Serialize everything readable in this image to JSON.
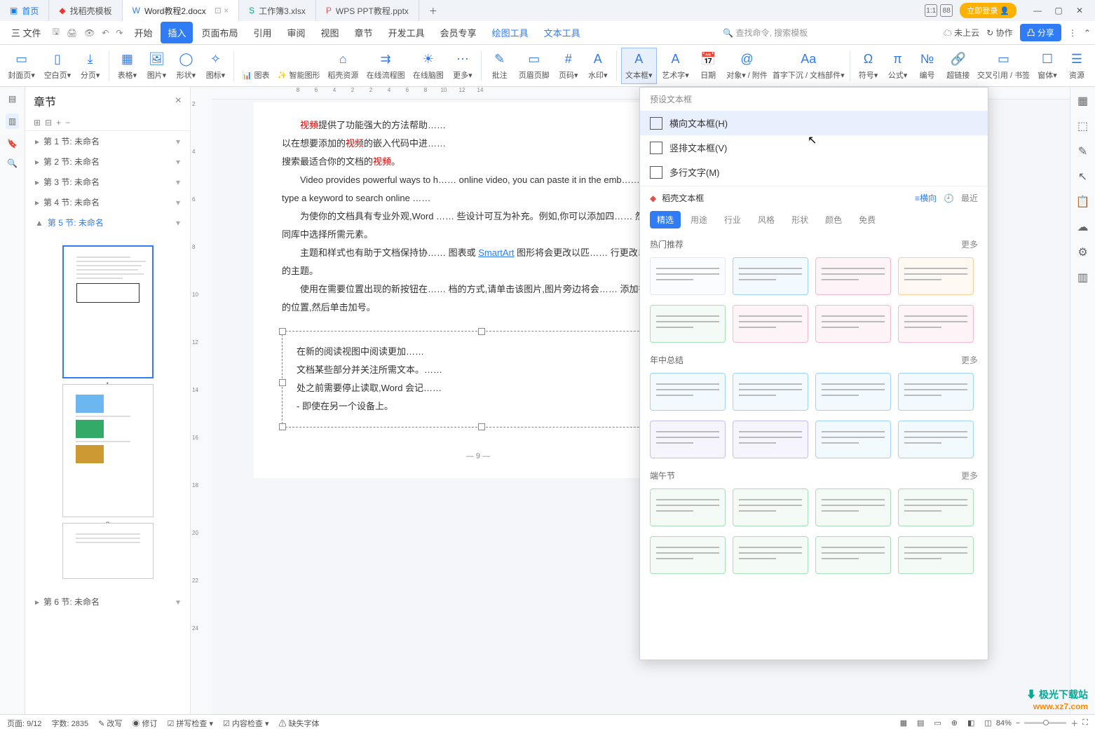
{
  "title_tabs": {
    "home": "首页",
    "t1": "找稻壳模板",
    "t2": "Word教程2.docx",
    "t3": "工作簿3.xlsx",
    "t4": "WPS PPT教程.pptx"
  },
  "win": {
    "login": "立即登录",
    "box1": "1:1",
    "box2": "88"
  },
  "menu": {
    "file": "三 文件",
    "items": [
      "开始",
      "插入",
      "页面布局",
      "引用",
      "审阅",
      "视图",
      "章节",
      "开发工具",
      "会员专享",
      "绘图工具",
      "文本工具"
    ],
    "active_index": 1,
    "search": "🔍 查找命令, 搜索模板",
    "right": {
      "cloud": "未上云",
      "coop": "协作",
      "share": "凸 分享"
    }
  },
  "ribbon": {
    "items": [
      {
        "lbl": "封面页▾",
        "ic": "▭"
      },
      {
        "lbl": "空白页▾",
        "ic": "▯"
      },
      {
        "lbl": "分页▾",
        "ic": "⤓"
      },
      {
        "lbl": "表格▾",
        "ic": "▦"
      },
      {
        "lbl": "图片▾",
        "ic": "🖼"
      },
      {
        "lbl": "形状▾",
        "ic": "◯"
      },
      {
        "lbl": "图标▾",
        "ic": "✧"
      },
      {
        "lbl": "📊 图表",
        "ic": ""
      },
      {
        "lbl": "✨ 智能图形",
        "ic": ""
      },
      {
        "lbl": "稻壳资源",
        "ic": "⌂"
      },
      {
        "lbl": "在线流程图",
        "ic": "⇉"
      },
      {
        "lbl": "在线脑图",
        "ic": "☀"
      },
      {
        "lbl": "更多▾",
        "ic": "⋯"
      },
      {
        "lbl": "批注",
        "ic": "✎"
      },
      {
        "lbl": "页眉页脚",
        "ic": "▭"
      },
      {
        "lbl": "页码▾",
        "ic": "#"
      },
      {
        "lbl": "水印▾",
        "ic": "A"
      },
      {
        "lbl": "文本框▾",
        "ic": "A",
        "sel": true
      },
      {
        "lbl": "艺术字▾",
        "ic": "A"
      },
      {
        "lbl": "日期",
        "ic": "📅"
      },
      {
        "lbl": "对象▾ / 附件",
        "ic": "@"
      },
      {
        "lbl": "首字下沉 / 文档部件▾",
        "ic": "Aa"
      },
      {
        "lbl": "符号▾",
        "ic": "Ω"
      },
      {
        "lbl": "公式▾",
        "ic": "π"
      },
      {
        "lbl": "编号",
        "ic": "№"
      },
      {
        "lbl": "超链接",
        "ic": "🔗"
      },
      {
        "lbl": "交叉引用 / 书签",
        "ic": "▭"
      },
      {
        "lbl": "窗体▾",
        "ic": "☐"
      },
      {
        "lbl": "资源",
        "ic": "☰"
      }
    ]
  },
  "chapters": {
    "title": "章节",
    "items": [
      {
        "txt": "第 1 节: 未命名"
      },
      {
        "txt": "第 2 节: 未命名"
      },
      {
        "txt": "第 3 节: 未命名"
      },
      {
        "txt": "第 4 节: 未命名"
      },
      {
        "txt": "第 5 节: 未命名",
        "active": true
      },
      {
        "txt": "第 6 节: 未命名"
      }
    ],
    "pages": [
      "1",
      "2"
    ]
  },
  "doc": {
    "p1a": "视频",
    "p1b": "提供了功能强大的方法帮助……",
    "p1c": "以在想要添加的",
    "p1d": "视频",
    "p1e": "的嵌入代码中进……",
    "p1f": "搜索最适合你的文档的",
    "p1g": "视频",
    "p1h": "。",
    "p2": "Video provides powerful ways to h…… online video, you can paste it in the emb…… you can type a keyword to search online ……",
    "p3": "为使你的文档具有专业外观,Word …… 些设计可互为补充。例如,你可以添加四…… 然后从不同库中选择所需元素。",
    "p4a": "主题和样式也有助于文档保持协…… 图表或 ",
    "smart": "SmartArt",
    "p4b": " 图形将会更改以匹…… 行更改以匹配新的主题。",
    "p5": "使用在需要位置出现的新按钮在…… 档的方式,请单击该图片,图片旁边将会…… 添加行或列的位置,然后单击加号。",
    "t1": "在新的阅读视图中阅读更加……",
    "t2": "文档某些部分并关注所需文本。……",
    "t3": "处之前需要停止读取,Word 会记……",
    "t4": "- 即使在另一个设备上。",
    "pg": "— 9 —"
  },
  "ruler_h": [
    "8",
    "6",
    "4",
    "2",
    "2",
    "4",
    "6",
    "8",
    "10",
    "12",
    "14"
  ],
  "ruler_v": [
    "2",
    "4",
    "6",
    "8",
    "10",
    "12",
    "14",
    "16",
    "18",
    "20",
    "22",
    "24"
  ],
  "dropdown": {
    "preset_title": "预设文本框",
    "opts": [
      {
        "txt": "横向文本框(H)",
        "hover": true
      },
      {
        "txt": "竖排文本框(V)"
      },
      {
        "txt": "多行文字(M)"
      }
    ],
    "docer": "稻壳文本框",
    "orient": "≡横向",
    "recent": "最近",
    "tabs": [
      "精选",
      "用途",
      "行业",
      "风格",
      "形状",
      "颜色",
      "免费"
    ],
    "tab_active": 0,
    "groups": [
      {
        "title": "热门推荐",
        "more": "更多"
      },
      {
        "title": "年中总结",
        "more": "更多"
      },
      {
        "title": "端午节",
        "more": "更多"
      }
    ]
  },
  "status": {
    "page": "页面: 9/12",
    "words": "字数: 2835",
    "edit": "✎ 改写",
    "track": "◉ 修订",
    "spell": "☑ 拼写检查 ▾",
    "content": "☑ 内容检查 ▾",
    "missing": "⚠ 缺失字体",
    "zoom": "84%"
  },
  "watermark": {
    "w1": "⬇ 极光下载站",
    "w2": "www.xz7.com"
  }
}
